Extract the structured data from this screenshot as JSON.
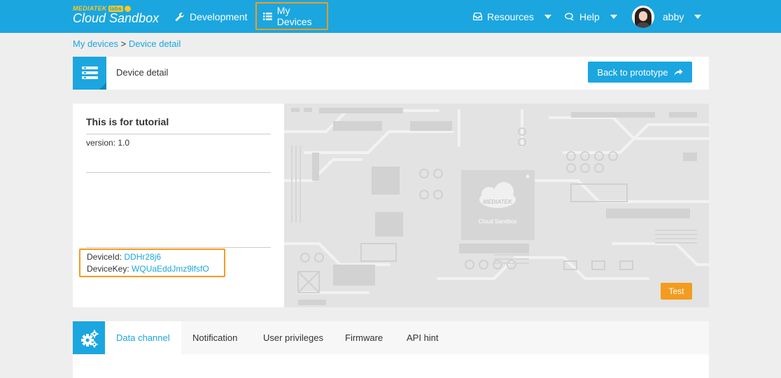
{
  "brand": {
    "top": "MEDIATEK",
    "labs": "labs",
    "main": "Cloud Sandbox"
  },
  "nav": {
    "development": "Development",
    "my_devices": "My Devices",
    "resources": "Resources",
    "help": "Help",
    "user": "abby"
  },
  "breadcrumb": {
    "parent": "My devices",
    "separator": " > ",
    "current": "Device detail"
  },
  "header": {
    "title": "Device detail",
    "back_button": "Back to prototype"
  },
  "device": {
    "name": "This is for tutorial",
    "version": "version: 1.0",
    "id_label": "DeviceId: ",
    "id_value": "DDHr28j6",
    "key_label": "DeviceKey: ",
    "key_value": "WQUaEddJmz9lfsfO",
    "chip_brand": "MEDIATEK",
    "chip_label": "Cloud Sandbox",
    "test_button": "Test"
  },
  "tabs": [
    "Data channel",
    "Notification",
    "User privileges",
    "Firmware",
    "API hint"
  ],
  "colors": {
    "primary": "#1ba6e0",
    "highlight": "#f39c1f"
  }
}
